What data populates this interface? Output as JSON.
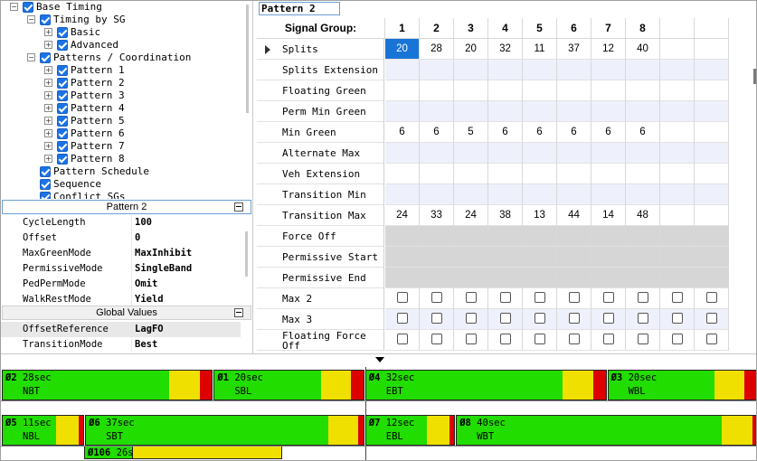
{
  "tree": {
    "items": [
      {
        "label": "Base Timing",
        "indent": 0,
        "expander": "minus"
      },
      {
        "label": "Timing by SG",
        "indent": 1,
        "expander": "minus"
      },
      {
        "label": "Basic",
        "indent": 2,
        "expander": "plus"
      },
      {
        "label": "Advanced",
        "indent": 2,
        "expander": "plus"
      },
      {
        "label": "Patterns / Coordination",
        "indent": 1,
        "expander": "minus"
      },
      {
        "label": "Pattern 1",
        "indent": 2,
        "expander": "plus"
      },
      {
        "label": "Pattern 2",
        "indent": 2,
        "expander": "plus"
      },
      {
        "label": "Pattern 3",
        "indent": 2,
        "expander": "plus"
      },
      {
        "label": "Pattern 4",
        "indent": 2,
        "expander": "plus"
      },
      {
        "label": "Pattern 5",
        "indent": 2,
        "expander": "plus"
      },
      {
        "label": "Pattern 6",
        "indent": 2,
        "expander": "plus"
      },
      {
        "label": "Pattern 7",
        "indent": 2,
        "expander": "plus"
      },
      {
        "label": "Pattern 8",
        "indent": 2,
        "expander": "plus"
      },
      {
        "label": "Pattern Schedule",
        "indent": 1,
        "expander": "none"
      },
      {
        "label": "Sequence",
        "indent": 1,
        "expander": "none"
      },
      {
        "label": "Conflict SGs",
        "indent": 1,
        "expander": "none"
      }
    ]
  },
  "props": {
    "section1": "Pattern 2",
    "rows1": [
      {
        "name": "CycleLength",
        "value": "100"
      },
      {
        "name": "Offset",
        "value": "0"
      },
      {
        "name": "MaxGreenMode",
        "value": "MaxInhibit"
      },
      {
        "name": "PermissiveMode",
        "value": "SingleBand"
      },
      {
        "name": "PedPermMode",
        "value": "Omit"
      },
      {
        "name": "WalkRestMode",
        "value": "Yield"
      }
    ],
    "section2": "Global Values",
    "rows2": [
      {
        "name": "OffsetReference",
        "value": "LagFO"
      },
      {
        "name": "TransitionMode",
        "value": "Best"
      }
    ]
  },
  "grid": {
    "title": "Pattern 2",
    "header_label": "Signal Group:",
    "columns": [
      "1",
      "2",
      "3",
      "4",
      "5",
      "6",
      "7",
      "8",
      "",
      ""
    ],
    "rows": [
      {
        "label": "Splits",
        "values": [
          "20",
          "28",
          "20",
          "32",
          "11",
          "37",
          "12",
          "40",
          "",
          ""
        ],
        "type": "value",
        "current": true
      },
      {
        "label": "Splits Extension",
        "values": [
          "",
          "",
          "",
          "",
          "",
          "",
          "",
          "",
          "",
          ""
        ],
        "type": "value"
      },
      {
        "label": "Floating Green",
        "values": [
          "",
          "",
          "",
          "",
          "",
          "",
          "",
          "",
          "",
          ""
        ],
        "type": "value"
      },
      {
        "label": "Perm Min Green",
        "values": [
          "",
          "",
          "",
          "",
          "",
          "",
          "",
          "",
          "",
          ""
        ],
        "type": "value"
      },
      {
        "label": "Min Green",
        "values": [
          "6",
          "6",
          "5",
          "6",
          "6",
          "6",
          "6",
          "6",
          "",
          ""
        ],
        "type": "value"
      },
      {
        "label": "Alternate Max",
        "values": [
          "",
          "",
          "",
          "",
          "",
          "",
          "",
          "",
          "",
          ""
        ],
        "type": "value"
      },
      {
        "label": "Veh Extension",
        "values": [
          "",
          "",
          "",
          "",
          "",
          "",
          "",
          "",
          "",
          ""
        ],
        "type": "value"
      },
      {
        "label": "Transition Min",
        "values": [
          "",
          "",
          "",
          "",
          "",
          "",
          "",
          "",
          "",
          ""
        ],
        "type": "value"
      },
      {
        "label": "Transition Max",
        "values": [
          "24",
          "33",
          "24",
          "38",
          "13",
          "44",
          "14",
          "48",
          "",
          ""
        ],
        "type": "value"
      },
      {
        "label": "Force Off",
        "values": [
          "",
          "",
          "",
          "",
          "",
          "",
          "",
          "",
          "",
          ""
        ],
        "type": "disabled"
      },
      {
        "label": "Permissive Start",
        "values": [
          "",
          "",
          "",
          "",
          "",
          "",
          "",
          "",
          "",
          ""
        ],
        "type": "disabled"
      },
      {
        "label": "Permissive End",
        "values": [
          "",
          "",
          "",
          "",
          "",
          "",
          "",
          "",
          "",
          ""
        ],
        "type": "disabled"
      },
      {
        "label": "Max 2",
        "values": [
          "",
          "",
          "",
          "",
          "",
          "",
          "",
          "",
          "",
          ""
        ],
        "type": "check"
      },
      {
        "label": "Max 3",
        "values": [
          "",
          "",
          "",
          "",
          "",
          "",
          "",
          "",
          "",
          ""
        ],
        "type": "check"
      },
      {
        "label": "Floating Force Off",
        "values": [
          "",
          "",
          "",
          "",
          "",
          "",
          "",
          "",
          "",
          ""
        ],
        "type": "check"
      }
    ]
  },
  "timing": {
    "cycle": 100,
    "ring1": [
      {
        "id": "Ø2",
        "dur": "28sec",
        "move": "NBT",
        "split": 28,
        "yellow": 4,
        "red": 2
      },
      {
        "id": "Ø1",
        "dur": "20sec",
        "move": "SBL",
        "split": 20,
        "yellow": 4,
        "red": 2
      },
      {
        "id": "Ø4",
        "dur": "32sec",
        "move": "EBT",
        "split": 32,
        "yellow": 4,
        "red": 2
      },
      {
        "id": "Ø3",
        "dur": "20sec",
        "move": "WBL",
        "split": 20,
        "yellow": 4,
        "red": 2
      }
    ],
    "ring2": [
      {
        "id": "Ø5",
        "dur": "11sec",
        "move": "NBL",
        "split": 11,
        "yellow": 3,
        "red": 1
      },
      {
        "id": "Ø6",
        "dur": "37sec",
        "move": "SBT",
        "split": 37,
        "yellow": 4,
        "red": 1
      },
      {
        "id": "Ø7",
        "dur": "12sec",
        "move": "EBL",
        "split": 12,
        "yellow": 3,
        "red": 1
      },
      {
        "id": "Ø8",
        "dur": "40sec",
        "move": "WBT",
        "split": 40,
        "yellow": 4,
        "red": 1
      }
    ],
    "overlap": {
      "id": "Ø106",
      "dur": "26s"
    },
    "colors": {
      "green": "#22dd00",
      "yellow": "#f0e000",
      "red": "#dd0000"
    }
  }
}
